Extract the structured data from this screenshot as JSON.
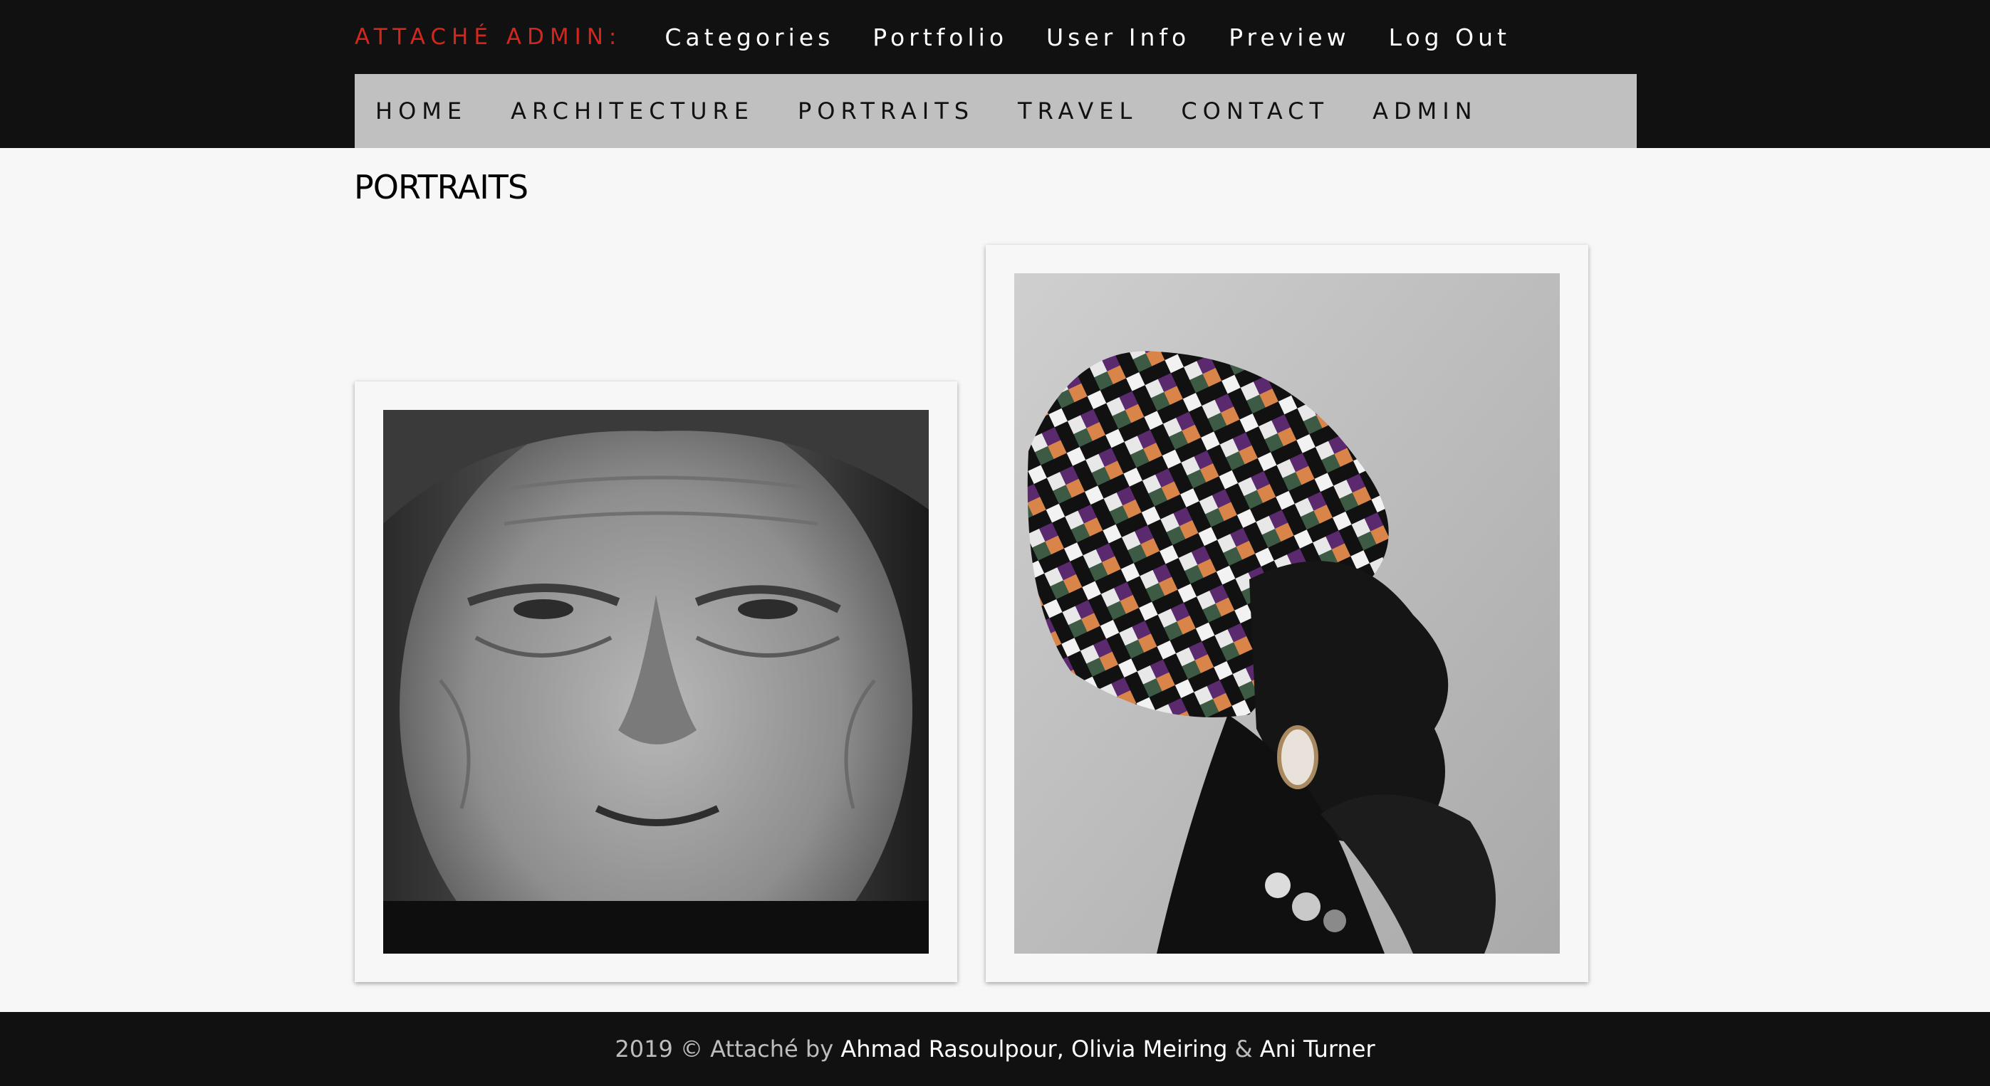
{
  "admin_bar": {
    "brand": "ATTACHÉ ADMIN:",
    "links": [
      "Categories",
      "Portfolio",
      "User Info",
      "Preview",
      "Log Out"
    ]
  },
  "site_nav": {
    "items": [
      "HOME",
      "ARCHITECTURE",
      "PORTRAITS",
      "TRAVEL",
      "CONTACT",
      "ADMIN"
    ]
  },
  "page": {
    "title": "PORTRAITS"
  },
  "gallery": {
    "photos": [
      {
        "subject": "elderly woman close-up portrait, black and white"
      },
      {
        "subject": "woman in patterned head wrap, profile portrait"
      }
    ]
  },
  "footer": {
    "prefix": "2019 © Attaché by ",
    "author1": "Ahmad Rasoulpour",
    "comma": ", ",
    "author2": "Olivia Meiring",
    "amp": " & ",
    "author3": "Ani Turner"
  },
  "colors": {
    "brand_red": "#d3271e",
    "bar_dark": "#111111",
    "nav_gray": "#c0c0c0",
    "page_bg": "#f7f7f7"
  }
}
